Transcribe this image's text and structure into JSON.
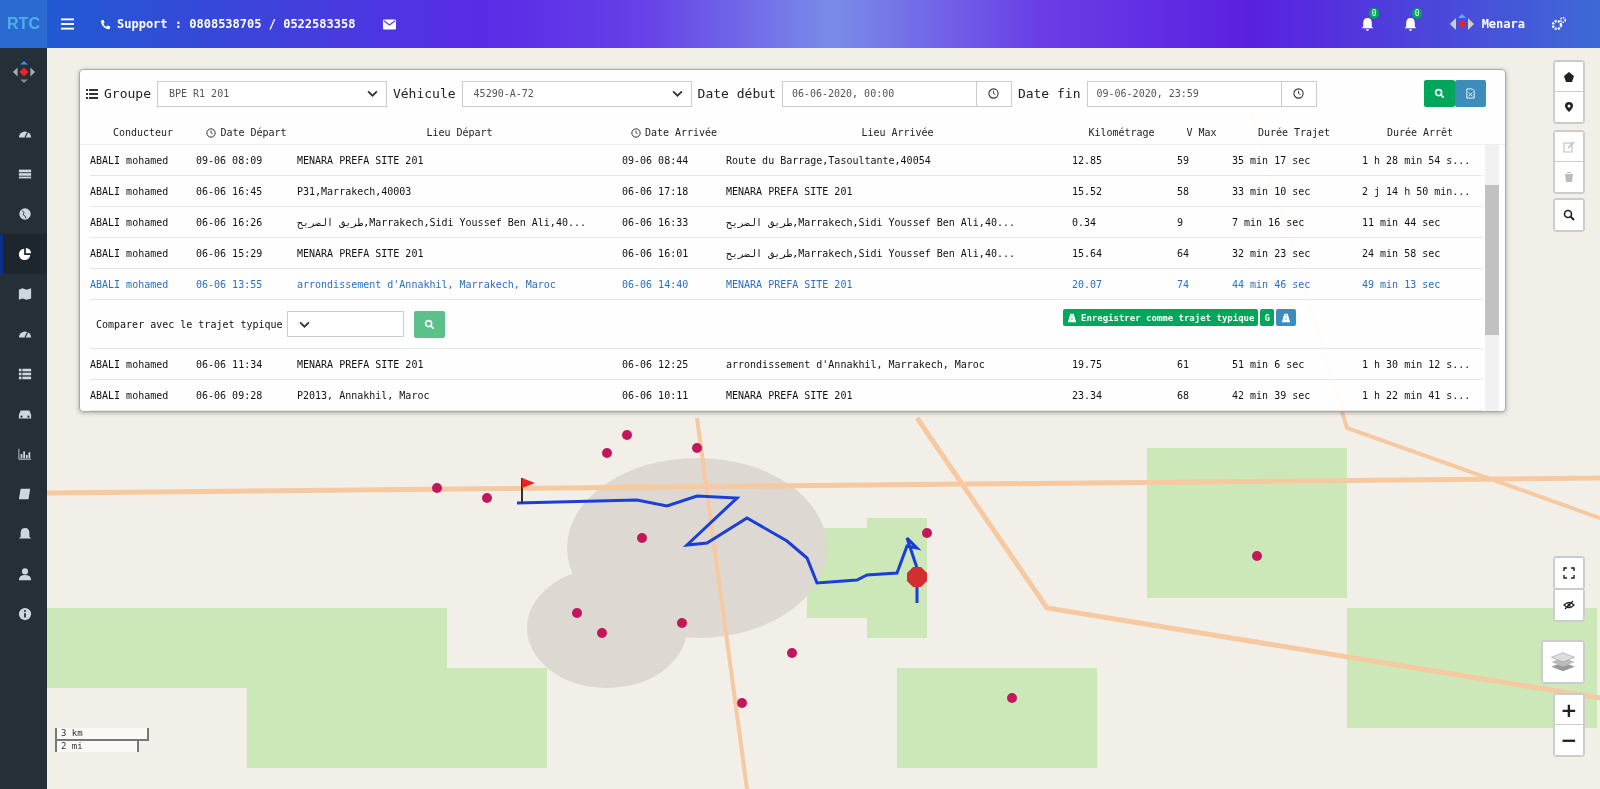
{
  "topbar": {
    "logo": "RTC",
    "support": "Support : 0808538705 / 0522583358",
    "notifications": [
      {
        "count": "0"
      },
      {
        "count": "0"
      }
    ],
    "user": "Menara"
  },
  "sidebar": {
    "items": [
      {
        "kind": "gauge",
        "selected": false
      },
      {
        "kind": "list",
        "selected": false
      },
      {
        "kind": "globe",
        "selected": false
      },
      {
        "kind": "pie",
        "selected": true
      },
      {
        "kind": "map",
        "selected": false
      },
      {
        "kind": "gauge",
        "selected": false
      },
      {
        "kind": "table",
        "selected": false
      },
      {
        "kind": "car",
        "selected": false
      },
      {
        "kind": "chart",
        "selected": false
      },
      {
        "kind": "book",
        "selected": false
      },
      {
        "kind": "bell",
        "selected": false
      },
      {
        "kind": "user",
        "selected": false
      },
      {
        "kind": "info",
        "selected": false
      }
    ]
  },
  "filters": {
    "group_label": "Groupe",
    "group_value": "BPE R1 201",
    "vehicle_label": "Véhicule",
    "vehicle_value": "45290-A-72",
    "start_label": "Date début",
    "start_value": "06-06-2020, 00:00",
    "end_label": "Date fin",
    "end_value": "09-06-2020, 23:59"
  },
  "table": {
    "columns": [
      {
        "label": "Conducteur",
        "kind": "text"
      },
      {
        "label": "Date Départ",
        "kind": "time"
      },
      {
        "label": "Lieu Départ",
        "kind": "text"
      },
      {
        "label": "Date Arrivée",
        "kind": "time"
      },
      {
        "label": "Lieu Arrivée",
        "kind": "text"
      },
      {
        "label": "Kilométrage",
        "kind": "text"
      },
      {
        "label": "V Max",
        "kind": "text"
      },
      {
        "label": "Durée Trajet",
        "kind": "text"
      },
      {
        "label": "Durée Arrêt",
        "kind": "text"
      }
    ],
    "rows": [
      {
        "cells": [
          "ABALI mohamed",
          "09-06 08:09",
          "MENARA PREFA SITE 201",
          "09-06 08:44",
          "Route du Barrage,Tasoultante,40054",
          "12.85",
          "59",
          "35 min 17 sec",
          "1 h 28 min 54 s..."
        ],
        "selected": false
      },
      {
        "cells": [
          "ABALI mohamed",
          "06-06 16:45",
          "P31,Marrakech,40003",
          "06-06 17:18",
          "MENARA PREFA SITE 201",
          "15.52",
          "58",
          "33 min 10 sec",
          "2 j 14 h 50 min..."
        ],
        "selected": false
      },
      {
        "cells": [
          "ABALI mohamed",
          "06-06 16:26",
          "طريق الضريح,Marrakech,Sidi Youssef Ben Ali,40...",
          "06-06 16:33",
          "طريق الضريح,Marrakech,Sidi Youssef Ben Ali,40...",
          "0.34",
          "9",
          "7 min 16 sec",
          "11 min 44 sec"
        ],
        "selected": false
      },
      {
        "cells": [
          "ABALI mohamed",
          "06-06 15:29",
          "MENARA PREFA SITE 201",
          "06-06 16:01",
          "طريق الضريح,Marrakech,Sidi Youssef Ben Ali,40...",
          "15.64",
          "64",
          "32 min 23 sec",
          "24 min 58 sec"
        ],
        "selected": false
      },
      {
        "cells": [
          "ABALI mohamed",
          "06-06 13:55",
          "arrondissement d'Annakhil, Marrakech, Maroc",
          "06-06 14:40",
          "MENARA PREFA SITE 201",
          "20.07",
          "74",
          "44 min 46 sec",
          "49 min 13 sec"
        ],
        "selected": true
      },
      {
        "cells": [
          "ABALI mohamed",
          "06-06 11:34",
          "MENARA PREFA SITE 201",
          "06-06 12:25",
          "arrondissement d'Annakhil, Marrakech, Maroc",
          "19.75",
          "61",
          "51 min 6 sec",
          "1 h 30 min 12 s..."
        ],
        "selected": false
      },
      {
        "cells": [
          "ABALI mohamed",
          "06-06 09:28",
          "P2013, Annakhil, Maroc",
          "06-06 10:11",
          "MENARA PREFA SITE 201",
          "23.34",
          "68",
          "42 min 39 sec",
          "1 h 22 min 41 s..."
        ],
        "selected": false
      }
    ]
  },
  "compare": {
    "label": "Comparer avec le trajet typique",
    "save_button": "Enregistrer comme trajet typique",
    "g_button": "G"
  },
  "map": {
    "scale_km": "3 km",
    "scale_mi": "2 mi",
    "zoom_in": "+",
    "zoom_out": "−"
  }
}
